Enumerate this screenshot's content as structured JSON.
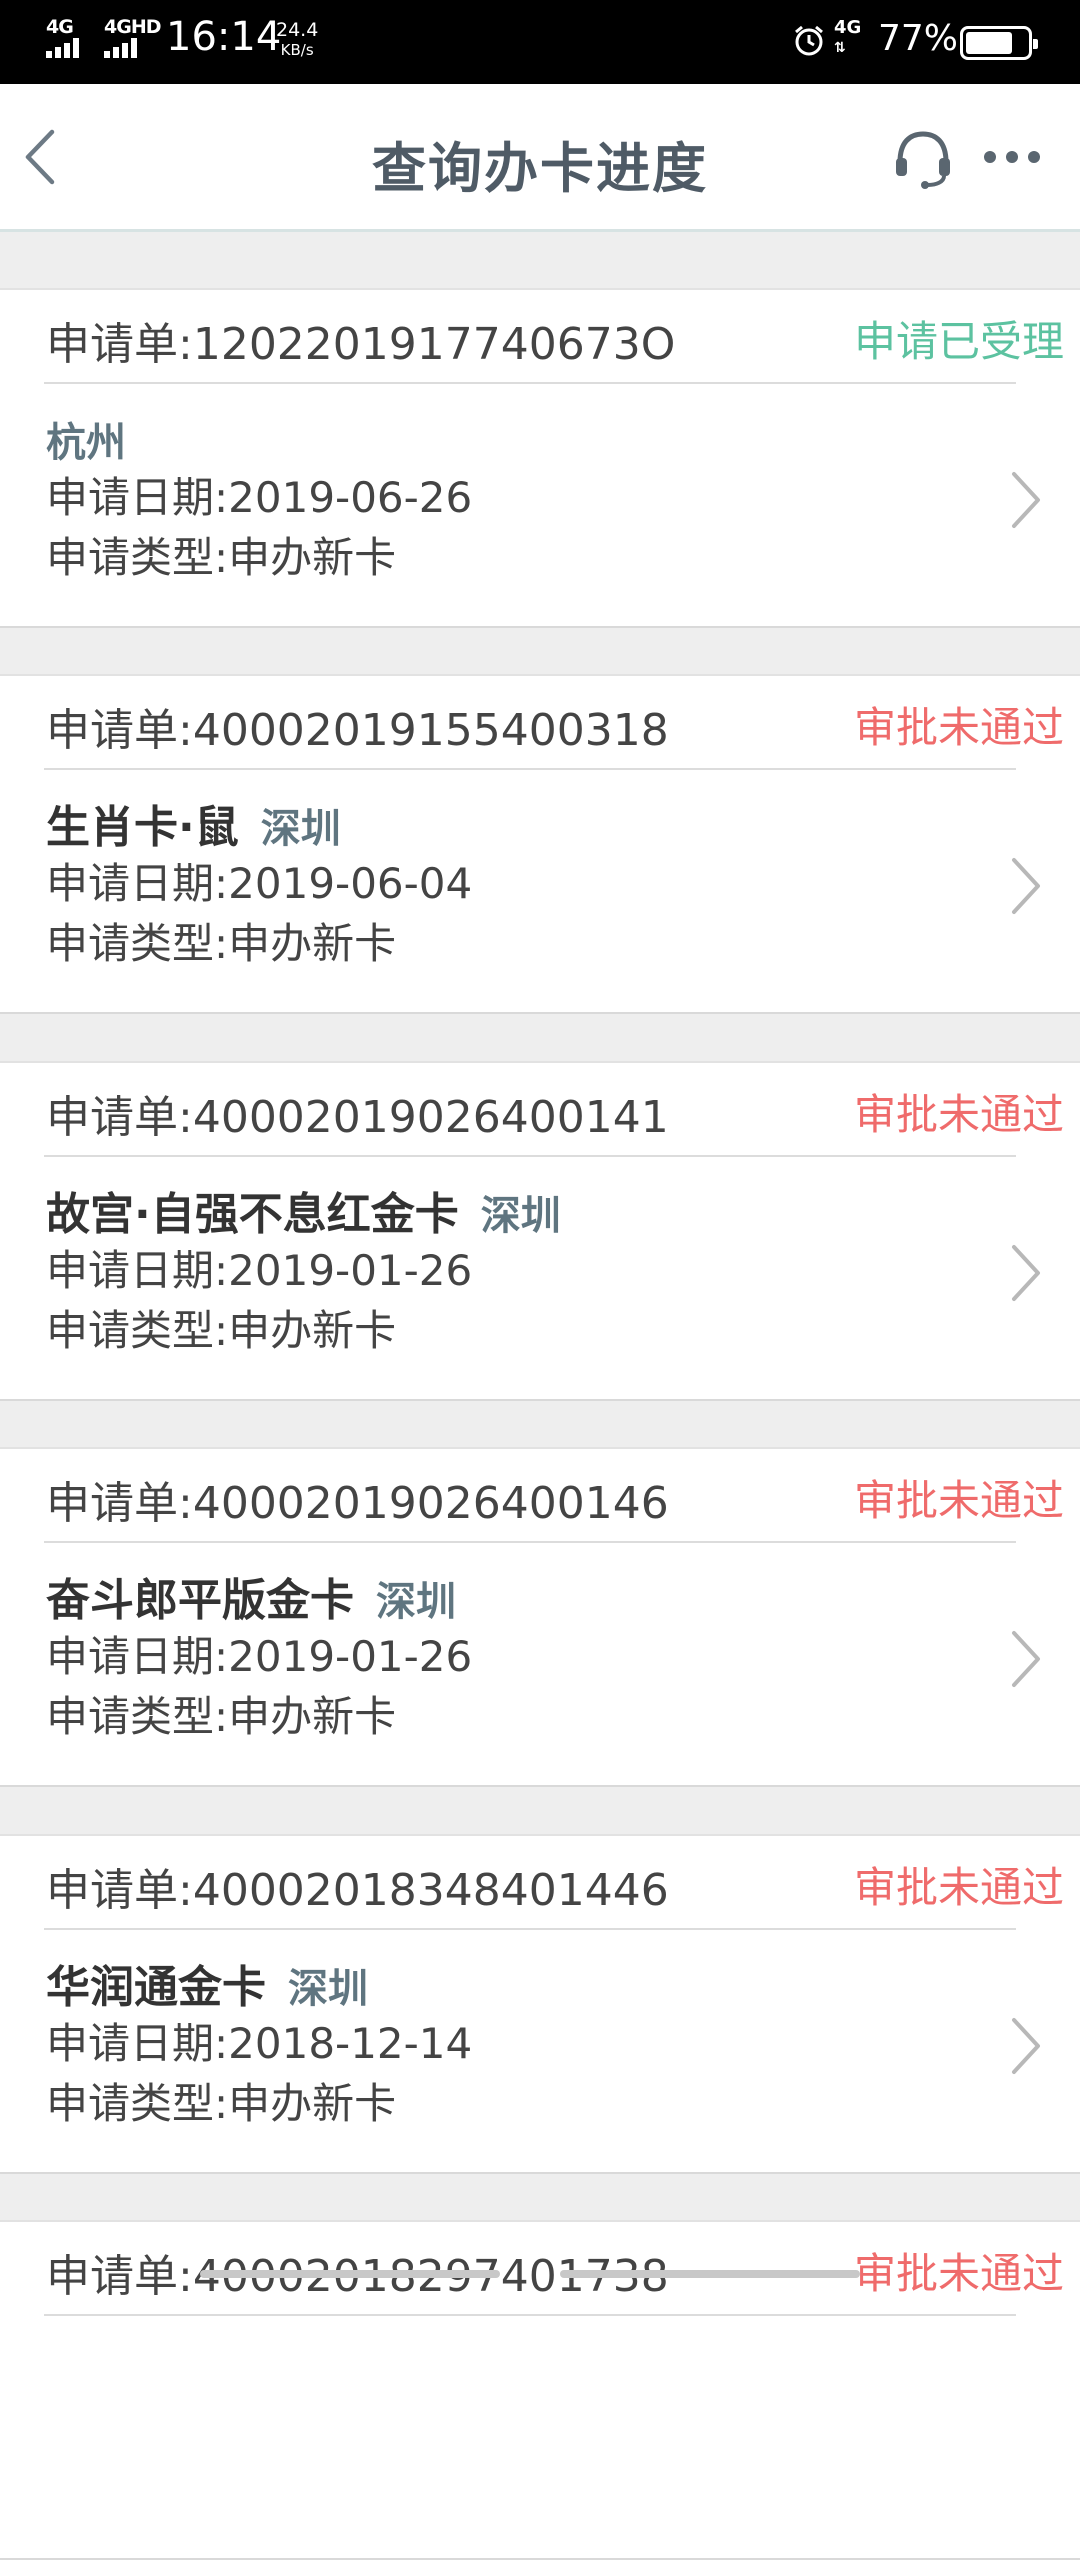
{
  "status_bar": {
    "signal_1": "4G",
    "signal_2": "4GHD",
    "time": "16:14",
    "speed_value": "24.4",
    "speed_unit": "KB/s",
    "network": "4G",
    "battery_percent": "77%",
    "battery_level": 0.77
  },
  "nav": {
    "title": "查询办卡进度",
    "back_icon": "chevron-left-icon",
    "service_icon": "headset-icon",
    "more_icon": "more-icon"
  },
  "colors": {
    "status_accepted": "#5cc2a0",
    "status_rejected": "#ef6b6b",
    "city": "#5f7580",
    "title": "#4f5b66"
  },
  "labels": {
    "application_no": "申请单:",
    "date": "申请日期:",
    "type": "申请类型:"
  },
  "applications": [
    {
      "number": "1202201917740673O",
      "status": "申请已受理",
      "card_name": "",
      "city": "杭州",
      "date": "2019-06-26",
      "type": "申办新卡"
    },
    {
      "number": "40002019155400318",
      "status": "审批未通过",
      "card_name": "生肖卡·鼠",
      "city": "深圳",
      "date": "2019-06-04",
      "type": "申办新卡"
    },
    {
      "number": "40002019026400141",
      "status": "审批未通过",
      "card_name": "故宫·自强不息红金卡",
      "city": "深圳",
      "date": "2019-01-26",
      "type": "申办新卡"
    },
    {
      "number": "40002019026400146",
      "status": "审批未通过",
      "card_name": "奋斗郎平版金卡",
      "city": "深圳",
      "date": "2019-01-26",
      "type": "申办新卡"
    },
    {
      "number": "40002018348401446",
      "status": "审批未通过",
      "card_name": "华润通金卡",
      "city": "深圳",
      "date": "2018-12-14",
      "type": "申办新卡"
    },
    {
      "number": "40002018297401738",
      "status": "审批未通过",
      "card_name": "",
      "city": "",
      "date": "",
      "type": ""
    }
  ]
}
